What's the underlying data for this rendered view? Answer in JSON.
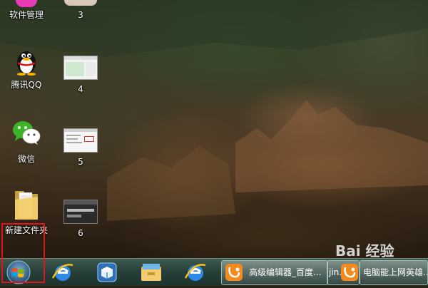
{
  "desktop": {
    "icons": [
      {
        "label": "软件管理"
      },
      {
        "label": "腾讯QQ"
      },
      {
        "label": "微信"
      },
      {
        "label": "新建文件夹"
      }
    ],
    "thumbnails": [
      {
        "label": "3"
      },
      {
        "label": "4"
      },
      {
        "label": "5"
      },
      {
        "label": "6"
      }
    ]
  },
  "taskbar": {
    "start_icon": "windows-logo-icon",
    "pinned": [
      "ie-icon",
      "package-icon",
      "file-explorer-icon",
      "ie-icon"
    ],
    "tasks": [
      {
        "label": "高级编辑器_百度...",
        "icon": "uc-browser-icon"
      },
      {
        "label": "jin...",
        "icon": "uc-browser-icon"
      },
      {
        "label": "电脑能上网英雄...",
        "icon": "uc-browser-icon"
      }
    ]
  },
  "watermark": {
    "text": "Bai 经验"
  },
  "colors": {
    "highlight_box": "#e0141a",
    "taskbar": "#27403a"
  }
}
